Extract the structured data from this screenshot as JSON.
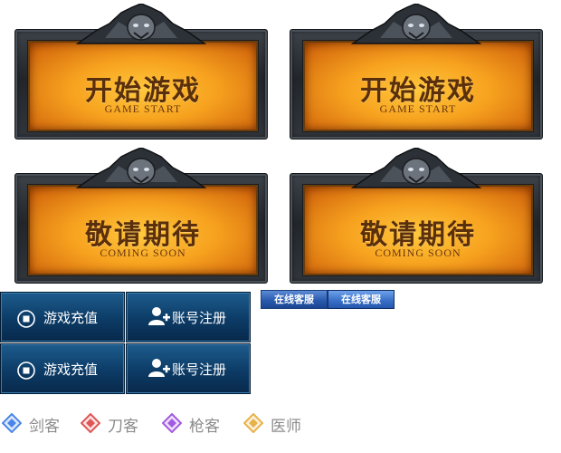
{
  "cards": [
    {
      "title": "开始游戏",
      "subtitle": "GAME START"
    },
    {
      "title": "开始游戏",
      "subtitle": "GAME START"
    },
    {
      "title": "敬请期待",
      "subtitle": "COMING SOON"
    },
    {
      "title": "敬请期待",
      "subtitle": "COMING SOON"
    }
  ],
  "buttons": {
    "recharge": "游戏充值",
    "register": "账号注册"
  },
  "service": {
    "label": "在线客服"
  },
  "classes": [
    {
      "name": "剑客",
      "color": "#4a86e8"
    },
    {
      "name": "刀客",
      "color": "#e05555"
    },
    {
      "name": "枪客",
      "color": "#a25ae0"
    },
    {
      "name": "医师",
      "color": "#e8b24a"
    }
  ]
}
